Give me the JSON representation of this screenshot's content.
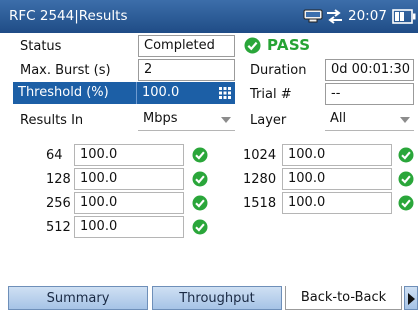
{
  "titlebar": {
    "title": "RFC 2544|Results",
    "clock": "20:07"
  },
  "summary": {
    "status_label": "Status",
    "status_value": "Completed",
    "verdict": "PASS",
    "max_burst_label": "Max. Burst (s)",
    "max_burst_value": "2",
    "duration_label": "Duration",
    "duration_value": "0d 00:01:30",
    "threshold_label": "Threshold (%)",
    "threshold_value": "100.0",
    "trial_label": "Trial #",
    "trial_value": "--",
    "results_in_label": "Results In",
    "results_in_value": "Mbps",
    "layer_label": "Layer",
    "layer_value": "All"
  },
  "results": [
    {
      "size": "64",
      "value": "100.0"
    },
    {
      "size": "128",
      "value": "100.0"
    },
    {
      "size": "256",
      "value": "100.0"
    },
    {
      "size": "512",
      "value": "100.0"
    },
    {
      "size": "1024",
      "value": "100.0"
    },
    {
      "size": "1280",
      "value": "100.0"
    },
    {
      "size": "1518",
      "value": "100.0"
    }
  ],
  "tabs": [
    {
      "label": "Summary"
    },
    {
      "label": "Throughput"
    },
    {
      "label": "Back-to-Back",
      "active": true
    }
  ],
  "colors": {
    "titlebar": "#1f4c86",
    "selected_row": "#1c5fa6",
    "pass_green": "#26a334",
    "tab": "#a6c3e6"
  },
  "icons": {
    "network": "network-icon",
    "swap": "swap-arrows-icon",
    "battery": "battery-icon",
    "check": "check-circle-icon",
    "keypad": "keypad-icon"
  }
}
